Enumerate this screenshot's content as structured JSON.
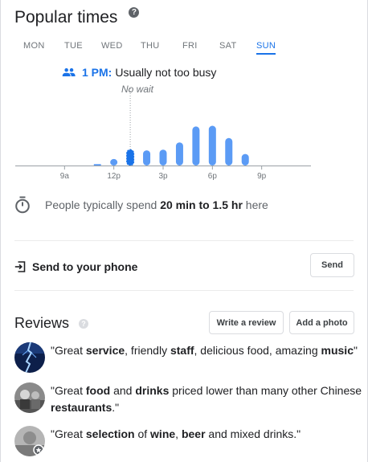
{
  "popular_times": {
    "title": "Popular times",
    "help_glyph": "?",
    "days": [
      "MON",
      "TUE",
      "WED",
      "THU",
      "FRI",
      "SAT",
      "SUN"
    ],
    "selected_day": "SUN",
    "current_time": "1 PM:",
    "current_status": "Usually not too busy",
    "wait": "No wait",
    "icons": {
      "help": "help-circle-icon",
      "people": "people-icon",
      "timer": "timer-icon"
    }
  },
  "chart_data": {
    "type": "bar",
    "x_hours": [
      11,
      12,
      13,
      14,
      15,
      16,
      17,
      18,
      19,
      20
    ],
    "values": [
      2,
      9,
      22,
      21,
      22,
      32,
      54,
      55,
      38,
      16
    ],
    "current_hour_index": 2,
    "ylim": [
      0,
      100
    ],
    "x_ticks": [
      "9a",
      "12p",
      "3p",
      "6p",
      "9p"
    ],
    "x_tick_hours": [
      9,
      12,
      15,
      18,
      21
    ],
    "xlim": [
      6,
      24
    ],
    "colors": {
      "bar": "#5b9bf5",
      "current": "#1a73e8",
      "baseline": "#9aa0a6"
    }
  },
  "stay": {
    "prefix": "People typically spend",
    "duration": "20 min to 1.5 hr",
    "suffix": "here"
  },
  "send": {
    "label": "Send to your phone",
    "button": "Send",
    "icon": "send-to-phone-icon"
  },
  "reviews": {
    "title": "Reviews",
    "help_glyph": "?",
    "write_button": "Write a review",
    "photo_button": "Add a photo",
    "items": [
      {
        "parts": [
          "\"Great ",
          "service",
          ", friendly ",
          "staff",
          ", delicious food, amazing ",
          "music",
          "\""
        ]
      },
      {
        "parts": [
          "\"Great ",
          "food",
          " and ",
          "drinks",
          " priced lower than many other Chinese ",
          "restaurants",
          ".\""
        ]
      },
      {
        "parts": [
          "\"Great ",
          "selection",
          " of ",
          "wine",
          ", ",
          "beer",
          " and mixed drinks.\""
        ]
      }
    ]
  }
}
